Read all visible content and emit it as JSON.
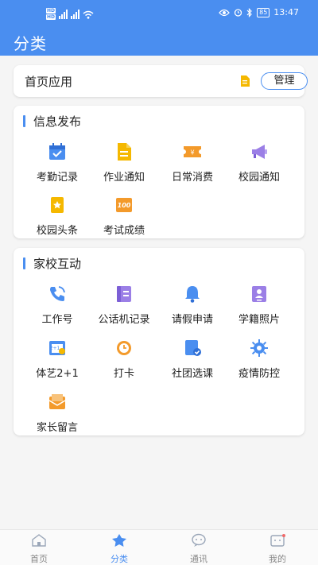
{
  "status_bar": {
    "time": "13:47",
    "battery": "85"
  },
  "header": {
    "title": "分类"
  },
  "home_apps": {
    "label": "首页应用",
    "manage_label": "管理"
  },
  "sections": [
    {
      "title": "信息发布",
      "items": [
        {
          "label": "考勤记录",
          "icon": "calendar-check-icon",
          "color": "#4a8ef0"
        },
        {
          "label": "作业通知",
          "icon": "document-icon",
          "color": "#f5b800"
        },
        {
          "label": "日常消费",
          "icon": "ticket-yen-icon",
          "color": "#f39a2b"
        },
        {
          "label": "校园通知",
          "icon": "megaphone-icon",
          "color": "#9b7fe6"
        },
        {
          "label": "校园头条",
          "icon": "bookmark-star-icon",
          "color": "#f5b800"
        },
        {
          "label": "考试成绩",
          "icon": "score-100-icon",
          "color": "#f39a2b"
        }
      ]
    },
    {
      "title": "家校互动",
      "items": [
        {
          "label": "工作号",
          "icon": "phone-icon",
          "color": "#4a8ef0"
        },
        {
          "label": "公话机记录",
          "icon": "notebook-icon",
          "color": "#9b7fe6"
        },
        {
          "label": "请假申请",
          "icon": "bell-icon",
          "color": "#4a8ef0"
        },
        {
          "label": "学籍照片",
          "icon": "id-card-icon",
          "color": "#9b7fe6"
        },
        {
          "label": "体艺2+1",
          "icon": "schedule-icon",
          "color": "#4a8ef0"
        },
        {
          "label": "打卡",
          "icon": "clock-icon",
          "color": "#f39a2b"
        },
        {
          "label": "社团选课",
          "icon": "book-check-icon",
          "color": "#4a8ef0"
        },
        {
          "label": "疫情防控",
          "icon": "virus-gear-icon",
          "color": "#4a8ef0"
        },
        {
          "label": "家长留言",
          "icon": "mailbox-icon",
          "color": "#f39a2b"
        }
      ]
    }
  ],
  "tabs": [
    {
      "label": "首页",
      "icon": "home-icon",
      "active": false
    },
    {
      "label": "分类",
      "icon": "category-icon",
      "active": true
    },
    {
      "label": "通讯",
      "icon": "chat-icon",
      "active": false
    },
    {
      "label": "我的",
      "icon": "profile-icon",
      "active": false
    }
  ],
  "colors": {
    "accent": "#4a8ef0",
    "background": "#f5f5f5"
  }
}
